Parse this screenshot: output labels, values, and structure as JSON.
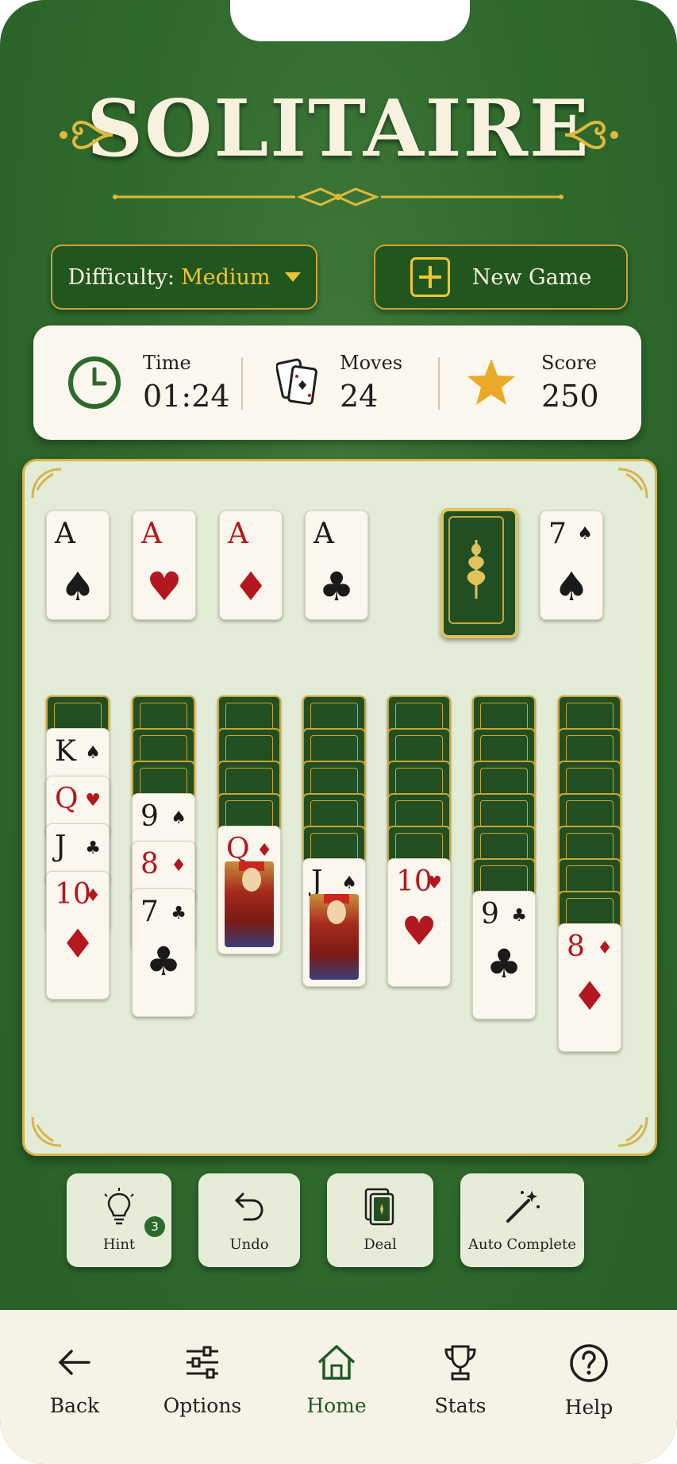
{
  "app": {
    "title": "SOLITAIRE"
  },
  "controls": {
    "difficulty_label": "Difficulty:",
    "difficulty_value": "Medium",
    "new_game_label": "New Game"
  },
  "stats": {
    "time_label": "Time",
    "time_value": "01:24",
    "moves_label": "Moves",
    "moves_value": "24",
    "score_label": "Score",
    "score_value": "250"
  },
  "foundations": [
    {
      "rank": "A",
      "suit": "♠",
      "color": "black"
    },
    {
      "rank": "A",
      "suit": "♥",
      "color": "red"
    },
    {
      "rank": "A",
      "suit": "♦",
      "color": "red"
    },
    {
      "rank": "A",
      "suit": "♣",
      "color": "black"
    }
  ],
  "waste": {
    "rank": "7",
    "suit": "♠",
    "color": "black"
  },
  "tableau": [
    {
      "face_down": 1,
      "face_up": [
        {
          "rank": "K",
          "suit": "♠",
          "color": "black"
        },
        {
          "rank": "Q",
          "suit": "♥",
          "color": "red"
        },
        {
          "rank": "J",
          "suit": "♣",
          "color": "black"
        },
        {
          "rank": "10",
          "suit": "♦",
          "color": "red"
        }
      ]
    },
    {
      "face_down": 3,
      "face_up": [
        {
          "rank": "9",
          "suit": "♠",
          "color": "black"
        },
        {
          "rank": "8",
          "suit": "♦",
          "color": "red"
        },
        {
          "rank": "7",
          "suit": "♣",
          "color": "black"
        }
      ]
    },
    {
      "face_down": 4,
      "face_up": [
        {
          "rank": "Q",
          "suit": "♦",
          "color": "red"
        }
      ]
    },
    {
      "face_down": 5,
      "face_up": [
        {
          "rank": "J",
          "suit": "♠",
          "color": "black"
        }
      ]
    },
    {
      "face_down": 5,
      "face_up": [
        {
          "rank": "10",
          "suit": "♥",
          "color": "red"
        }
      ]
    },
    {
      "face_down": 6,
      "face_up": [
        {
          "rank": "9",
          "suit": "♣",
          "color": "black"
        }
      ]
    },
    {
      "face_down": 7,
      "face_up": [
        {
          "rank": "8",
          "suit": "♦",
          "color": "red"
        }
      ]
    }
  ],
  "toolbar": {
    "hint_label": "Hint",
    "hint_count": "3",
    "undo_label": "Undo",
    "deal_label": "Deal",
    "auto_label": "Auto Complete"
  },
  "nav": {
    "back": "Back",
    "options": "Options",
    "home": "Home",
    "stats": "Stats",
    "help": "Help"
  },
  "colors": {
    "felt": "#2f6a2c",
    "gold": "#c9a534",
    "accent_yellow": "#f1c531",
    "card_red": "#b3171f"
  }
}
